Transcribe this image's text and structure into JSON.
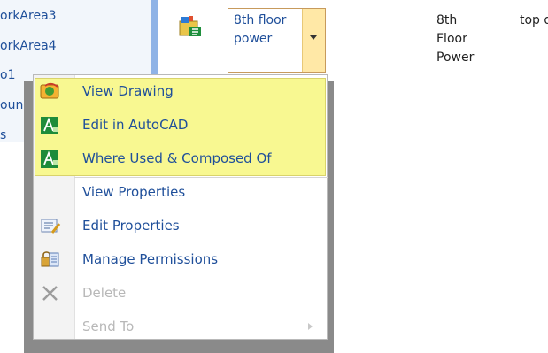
{
  "nav": {
    "items": [
      "orkArea3",
      "orkArea4",
      "o1",
      "oun",
      "s"
    ]
  },
  "document": {
    "name": "8th floor power",
    "title": "8th Floor Power",
    "description": "top drav"
  },
  "menu": {
    "items": [
      {
        "label": "View Drawing",
        "icon": "view-drawing-icon",
        "disabled": false
      },
      {
        "label": "Edit in AutoCAD",
        "icon": "autocad-icon",
        "disabled": false
      },
      {
        "label": "Where Used & Composed Of",
        "icon": "autocad-icon",
        "disabled": false
      },
      {
        "label": "View Properties",
        "icon": "",
        "disabled": false
      },
      {
        "label": "Edit Properties",
        "icon": "edit-properties-icon",
        "disabled": false
      },
      {
        "label": "Manage Permissions",
        "icon": "manage-permissions-icon",
        "disabled": false
      },
      {
        "label": "Delete",
        "icon": "delete-icon",
        "disabled": true
      },
      {
        "label": "Send To",
        "icon": "",
        "disabled": true
      }
    ]
  },
  "colors": {
    "link": "#1f4f9a",
    "highlight": "#f8f891",
    "nav_divider": "#8fb3e6",
    "dropdown": "#ffe8a6"
  }
}
